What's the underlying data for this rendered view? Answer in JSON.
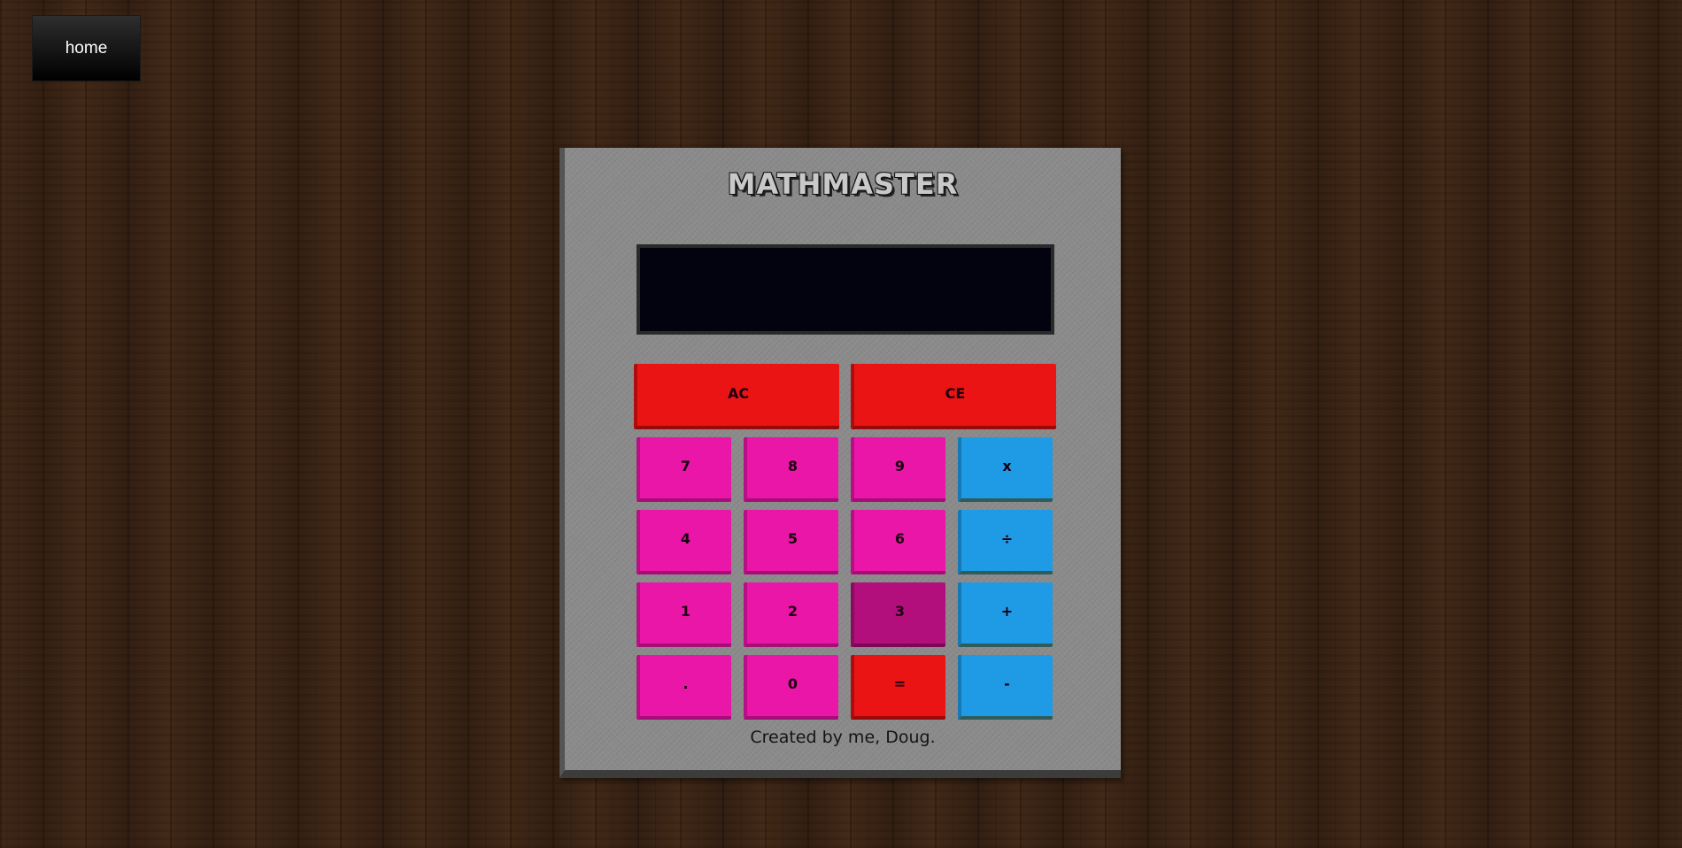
{
  "nav": {
    "home_label": "home"
  },
  "calculator": {
    "brand": "MATHMASTER",
    "display_value": "",
    "keys": {
      "ac": "AC",
      "ce": "CE",
      "k7": "7",
      "k8": "8",
      "k9": "9",
      "multiply": "x",
      "k4": "4",
      "k5": "5",
      "k6": "6",
      "divide": "÷",
      "k1": "1",
      "k2": "2",
      "k3": "3",
      "plus": "+",
      "decimal": ".",
      "k0": "0",
      "equals": "=",
      "minus": "-"
    },
    "pressed_key": "3",
    "credit": "Created by me, Doug."
  },
  "colors": {
    "number_key": "#ea16a8",
    "number_key_pressed": "#b30f7c",
    "clear_key": "#ea1414",
    "operator_key": "#1f9be6",
    "display_bg": "#02030f",
    "body_bg": "#8a8a8a"
  }
}
